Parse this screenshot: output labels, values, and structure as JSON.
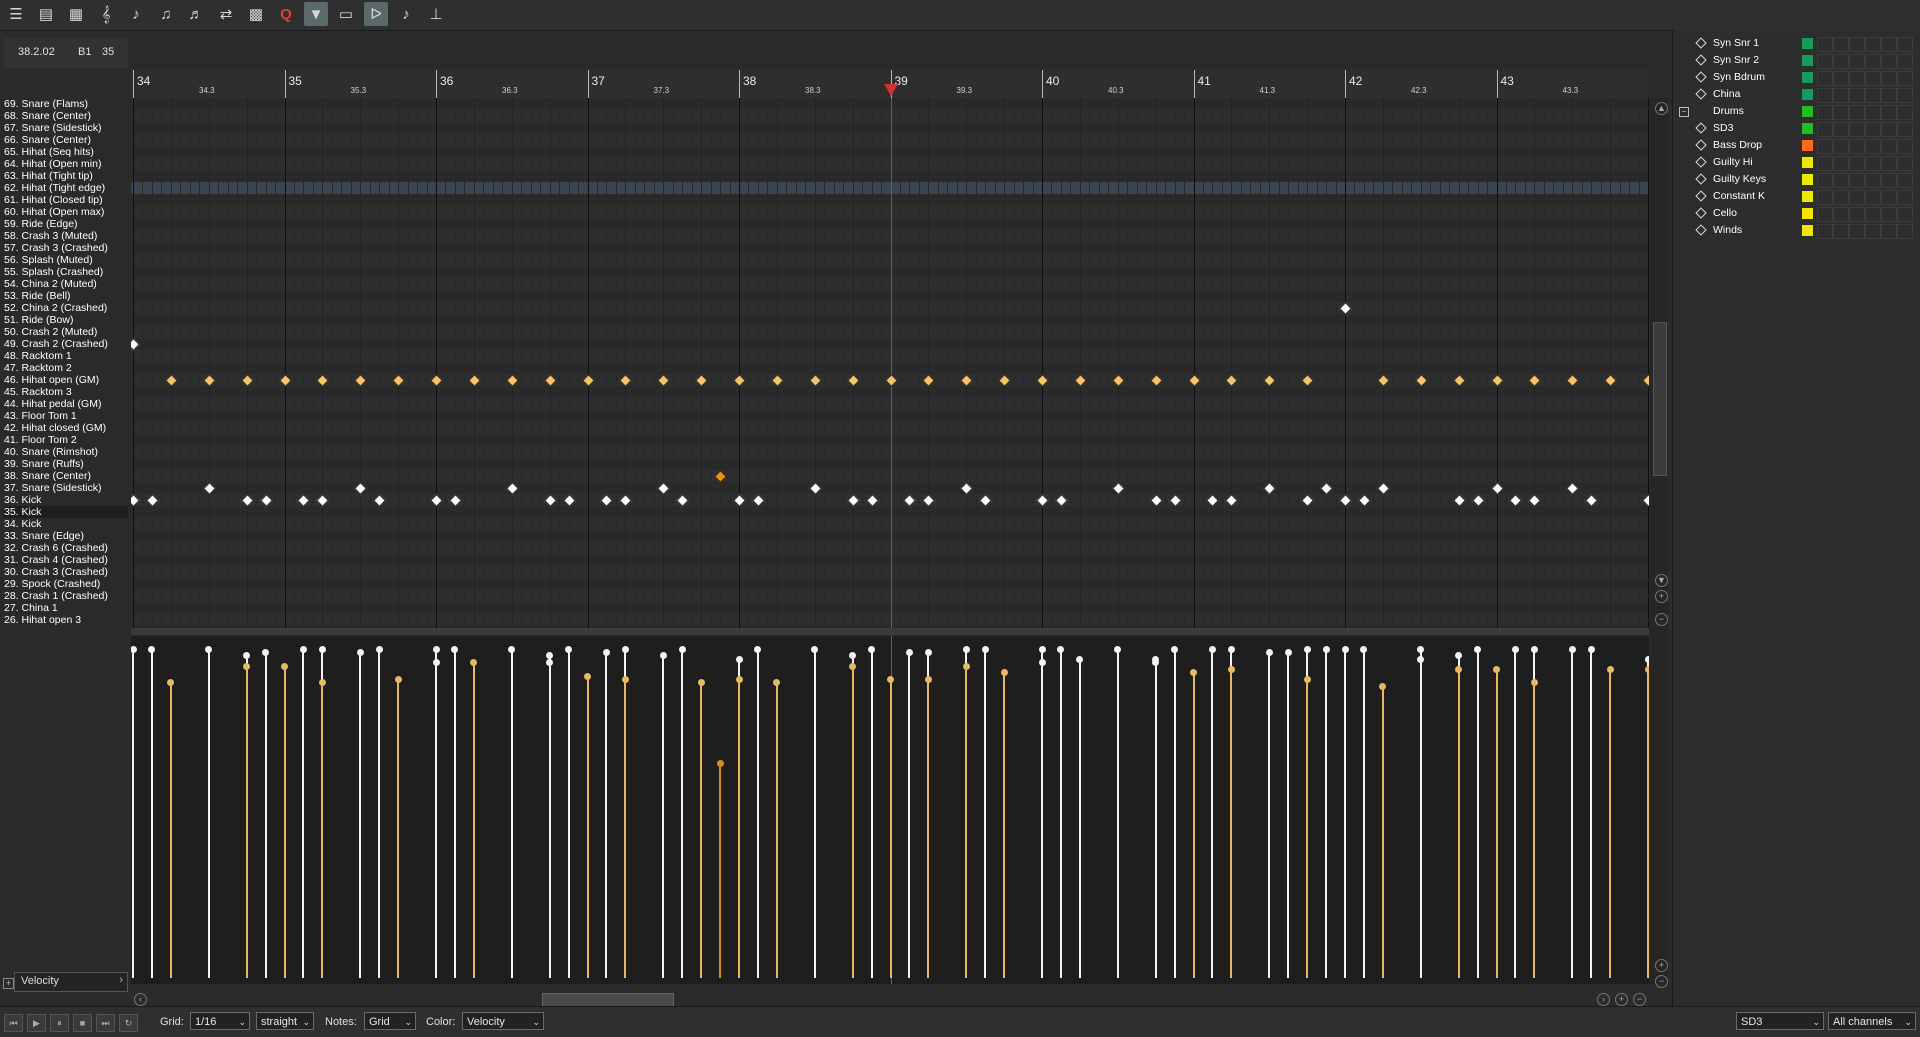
{
  "toolbar": {
    "buttons": [
      {
        "name": "menu-icon",
        "glyph": "☰",
        "active": false
      },
      {
        "name": "list-view-icon",
        "glyph": "▤",
        "active": false
      },
      {
        "name": "grid-view-icon",
        "glyph": "▦",
        "active": false
      },
      {
        "name": "treble-clef-icon",
        "glyph": "𝄞",
        "active": false
      },
      {
        "name": "step-record-icon",
        "glyph": "♪",
        "active": false
      },
      {
        "name": "play-note-icon",
        "glyph": "♫",
        "active": false
      },
      {
        "name": "note-preview-icon",
        "glyph": "♬",
        "active": false
      },
      {
        "name": "insert-note-icon",
        "glyph": "⇄",
        "active": false
      },
      {
        "name": "snap-grid-icon",
        "glyph": "▩",
        "active": false
      },
      {
        "name": "quantize-icon",
        "glyph": "Q",
        "active": false
      },
      {
        "name": "velocity-icon",
        "glyph": "▼",
        "active": true
      },
      {
        "name": "keyboard-icon",
        "glyph": "▭",
        "active": false
      },
      {
        "name": "loop-icon",
        "glyph": "ᐅ",
        "active": true
      },
      {
        "name": "step-input-icon",
        "glyph": "♪",
        "active": false
      },
      {
        "name": "cc-icon",
        "glyph": "⊥",
        "active": false
      }
    ]
  },
  "position": {
    "time": "38.2.02",
    "note": "B1",
    "velocity": "35"
  },
  "ruler": {
    "bars": [
      "34",
      "35",
      "36",
      "37",
      "38",
      "39",
      "40",
      "41",
      "42",
      "43"
    ],
    "beats": [
      "34.3",
      "35.3",
      "36.3",
      "37.3",
      "38.3",
      "39.3",
      "40.3",
      "41.3",
      "42.3",
      "43.3"
    ]
  },
  "note_names": [
    "69. Snare (Flams)",
    "68. Snare (Center)",
    "67. Snare (Sidestick)",
    "66. Snare (Center)",
    "65. Hihat (Seq hits)",
    "64. Hihat (Open min)",
    "63. Hihat (Tight tip)",
    "62. Hihat (Tight edge)",
    "61. Hihat (Closed tip)",
    "60. Hihat (Open max)",
    "59. Ride (Edge)",
    "58. Crash 3 (Muted)",
    "57. Crash 3 (Crashed)",
    "56. Splash (Muted)",
    "55. Splash (Crashed)",
    "54. China 2 (Muted)",
    "53. Ride (Bell)",
    "52. China 2 (Crashed)",
    "51. Ride (Bow)",
    "50. Crash 2 (Muted)",
    "49. Crash 2 (Crashed)",
    "48. Racktom 1",
    "47. Racktom 2",
    "46. Hihat open (GM)",
    "45. Racktom 3",
    "44. Hihat pedal (GM)",
    "43. Floor Tom 1",
    "42. Hihat closed (GM)",
    "41. Floor Tom 2",
    "40. Snare (Rimshot)",
    "39. Snare (Ruffs)",
    "38. Snare (Center)",
    "37. Snare (Sidestick)",
    "36. Kick",
    "35. Kick",
    "34. Kick",
    "33. Snare (Edge)",
    "32. Crash 6 (Crashed)",
    "31. Crash 4 (Crashed)",
    "30. Crash 3 (Crashed)",
    "29. Spock (Crashed)",
    "28. Crash 1 (Crashed)",
    "27. China 1",
    "26. Hihat open 3"
  ],
  "playhead_beat": 20,
  "notes": [
    {
      "key": "49. Crash 2 (Crashed)",
      "beat": 0,
      "vel": "white"
    },
    {
      "key": "52. China 2 (Crashed)",
      "beat": 32,
      "vel": "white"
    },
    {
      "key": "46. Hihat open (GM)",
      "beats": [
        1,
        2,
        3,
        4,
        5,
        6,
        7,
        8,
        9,
        10,
        11,
        12,
        13,
        14,
        15,
        16,
        17,
        18,
        19,
        20,
        21,
        22,
        23,
        24,
        25,
        26,
        27,
        28,
        29,
        30,
        31,
        33,
        34,
        35,
        36,
        37,
        38,
        39,
        40
      ]
    },
    {
      "key": "37. Snare (Sidestick)",
      "beats": [
        2,
        6,
        10,
        14,
        18,
        22,
        26,
        30,
        31.5,
        33,
        36,
        38
      ]
    },
    {
      "key": "38. Snare (Center)",
      "beat": 15.5,
      "vel": "orange"
    },
    {
      "key": "36. Kick",
      "beats": [
        0,
        0.5,
        3,
        3.5,
        4.5,
        5,
        6.5,
        8,
        8.5,
        11,
        11.5,
        12.5,
        13,
        14.5,
        16,
        16.5,
        19,
        19.5,
        20.5,
        21,
        22.5,
        24,
        24.5,
        27,
        27.5,
        28.5,
        29,
        31,
        32,
        32.5,
        35,
        35.5,
        36.5,
        37,
        38.5,
        40
      ]
    }
  ],
  "velocity_lane": {
    "label": "Velocity",
    "stems": [
      {
        "b": 0,
        "v": 0.98,
        "c": "white"
      },
      {
        "b": 0.5,
        "v": 0.98,
        "c": "white"
      },
      {
        "b": 1,
        "v": 0.88,
        "c": "tan"
      },
      {
        "b": 2,
        "v": 0.98,
        "c": "white"
      },
      {
        "b": 3,
        "v": 0.96,
        "c": "white"
      },
      {
        "b": 3,
        "v": 0.93,
        "c": "tan"
      },
      {
        "b": 3.5,
        "v": 0.97,
        "c": "white"
      },
      {
        "b": 4,
        "v": 0.93,
        "c": "tan"
      },
      {
        "b": 4.5,
        "v": 0.98,
        "c": "white"
      },
      {
        "b": 5,
        "v": 0.98,
        "c": "white"
      },
      {
        "b": 5,
        "v": 0.88,
        "c": "tan"
      },
      {
        "b": 6,
        "v": 0.97,
        "c": "white"
      },
      {
        "b": 6.5,
        "v": 0.98,
        "c": "white"
      },
      {
        "b": 7,
        "v": 0.89,
        "c": "tan"
      },
      {
        "b": 8,
        "v": 0.98,
        "c": "white"
      },
      {
        "b": 8,
        "v": 0.94,
        "c": "white"
      },
      {
        "b": 8.5,
        "v": 0.98,
        "c": "white"
      },
      {
        "b": 9,
        "v": 0.94,
        "c": "tan"
      },
      {
        "b": 10,
        "v": 0.98,
        "c": "white"
      },
      {
        "b": 11,
        "v": 0.96,
        "c": "white"
      },
      {
        "b": 11,
        "v": 0.94,
        "c": "white"
      },
      {
        "b": 11.5,
        "v": 0.98,
        "c": "white"
      },
      {
        "b": 12,
        "v": 0.9,
        "c": "tan"
      },
      {
        "b": 12.5,
        "v": 0.97,
        "c": "white"
      },
      {
        "b": 13,
        "v": 0.98,
        "c": "white"
      },
      {
        "b": 13,
        "v": 0.89,
        "c": "tan"
      },
      {
        "b": 14,
        "v": 0.96,
        "c": "white"
      },
      {
        "b": 14.5,
        "v": 0.98,
        "c": "white"
      },
      {
        "b": 15,
        "v": 0.88,
        "c": "tan"
      },
      {
        "b": 15.5,
        "v": 0.64,
        "c": "orange"
      },
      {
        "b": 16,
        "v": 0.95,
        "c": "white"
      },
      {
        "b": 16,
        "v": 0.89,
        "c": "tan"
      },
      {
        "b": 16.5,
        "v": 0.98,
        "c": "white"
      },
      {
        "b": 17,
        "v": 0.88,
        "c": "tan"
      },
      {
        "b": 18,
        "v": 0.98,
        "c": "white"
      },
      {
        "b": 19,
        "v": 0.96,
        "c": "white"
      },
      {
        "b": 19,
        "v": 0.93,
        "c": "tan"
      },
      {
        "b": 19.5,
        "v": 0.98,
        "c": "white"
      },
      {
        "b": 20,
        "v": 0.89,
        "c": "tan"
      },
      {
        "b": 20.5,
        "v": 0.97,
        "c": "white"
      },
      {
        "b": 21,
        "v": 0.97,
        "c": "white"
      },
      {
        "b": 21,
        "v": 0.89,
        "c": "tan"
      },
      {
        "b": 22,
        "v": 0.98,
        "c": "white"
      },
      {
        "b": 22,
        "v": 0.93,
        "c": "tan"
      },
      {
        "b": 22.5,
        "v": 0.98,
        "c": "white"
      },
      {
        "b": 23,
        "v": 0.91,
        "c": "tan"
      },
      {
        "b": 24,
        "v": 0.98,
        "c": "white"
      },
      {
        "b": 24,
        "v": 0.94,
        "c": "white"
      },
      {
        "b": 24.5,
        "v": 0.98,
        "c": "white"
      },
      {
        "b": 25,
        "v": 0.95,
        "c": "white"
      },
      {
        "b": 26,
        "v": 0.98,
        "c": "white"
      },
      {
        "b": 27,
        "v": 0.95,
        "c": "white"
      },
      {
        "b": 27,
        "v": 0.94,
        "c": "white"
      },
      {
        "b": 27.5,
        "v": 0.98,
        "c": "white"
      },
      {
        "b": 28,
        "v": 0.91,
        "c": "tan"
      },
      {
        "b": 28.5,
        "v": 0.98,
        "c": "white"
      },
      {
        "b": 29,
        "v": 0.98,
        "c": "white"
      },
      {
        "b": 29,
        "v": 0.92,
        "c": "tan"
      },
      {
        "b": 30,
        "v": 0.97,
        "c": "white"
      },
      {
        "b": 30.5,
        "v": 0.97,
        "c": "white"
      },
      {
        "b": 31,
        "v": 0.98,
        "c": "white"
      },
      {
        "b": 31,
        "v": 0.89,
        "c": "tan"
      },
      {
        "b": 31.5,
        "v": 0.98,
        "c": "white"
      },
      {
        "b": 32,
        "v": 0.98,
        "c": "white"
      },
      {
        "b": 32.5,
        "v": 0.98,
        "c": "white"
      },
      {
        "b": 33,
        "v": 0.87,
        "c": "tan"
      },
      {
        "b": 34,
        "v": 0.98,
        "c": "white"
      },
      {
        "b": 34,
        "v": 0.95,
        "c": "white"
      },
      {
        "b": 35,
        "v": 0.96,
        "c": "white"
      },
      {
        "b": 35,
        "v": 0.92,
        "c": "tan"
      },
      {
        "b": 35.5,
        "v": 0.98,
        "c": "white"
      },
      {
        "b": 36,
        "v": 0.92,
        "c": "tan"
      },
      {
        "b": 36.5,
        "v": 0.98,
        "c": "white"
      },
      {
        "b": 37,
        "v": 0.98,
        "c": "white"
      },
      {
        "b": 37,
        "v": 0.88,
        "c": "tan"
      },
      {
        "b": 38,
        "v": 0.98,
        "c": "white"
      },
      {
        "b": 38.5,
        "v": 0.98,
        "c": "white"
      },
      {
        "b": 39,
        "v": 0.92,
        "c": "tan"
      },
      {
        "b": 40,
        "v": 0.95,
        "c": "white"
      },
      {
        "b": 40,
        "v": 0.92,
        "c": "tan"
      }
    ]
  },
  "tracks": [
    {
      "name": "Syn Snr 1",
      "color": "#1a9a5a",
      "folder": false
    },
    {
      "name": "Syn Snr 2",
      "color": "#1a9a5a",
      "folder": false
    },
    {
      "name": "Syn Bdrum",
      "color": "#1a9a5a",
      "folder": false
    },
    {
      "name": "China",
      "color": "#1a9a5a",
      "folder": false
    },
    {
      "name": "Drums",
      "color": "#22bb22",
      "folder": true
    },
    {
      "name": "SD3",
      "color": "#22bb22",
      "folder": false
    },
    {
      "name": "Bass Drop",
      "color": "#ff6a1a",
      "folder": false
    },
    {
      "name": "Guilty Hi",
      "color": "#f2e600",
      "folder": false
    },
    {
      "name": "Guilty Keys",
      "color": "#f2e600",
      "folder": false
    },
    {
      "name": "Constant K",
      "color": "#f2e600",
      "folder": false
    },
    {
      "name": "Cello",
      "color": "#f2e600",
      "folder": false
    },
    {
      "name": "Winds",
      "color": "#f2e600",
      "folder": false
    }
  ],
  "bottom": {
    "grid_label": "Grid:",
    "grid_value": "1/16",
    "swing_value": "straight",
    "notes_label": "Notes:",
    "notes_value": "Grid",
    "color_label": "Color:",
    "color_value": "Velocity",
    "take_value": "SD3",
    "channels_value": "All channels"
  },
  "colors": {
    "note_hihat": "#f5c36a",
    "note_white": "#ffffff",
    "note_orange": "#e8921a",
    "stem_tan": "#e8b862",
    "stem_orange": "#d98a1a",
    "playhead": "#d33030"
  }
}
